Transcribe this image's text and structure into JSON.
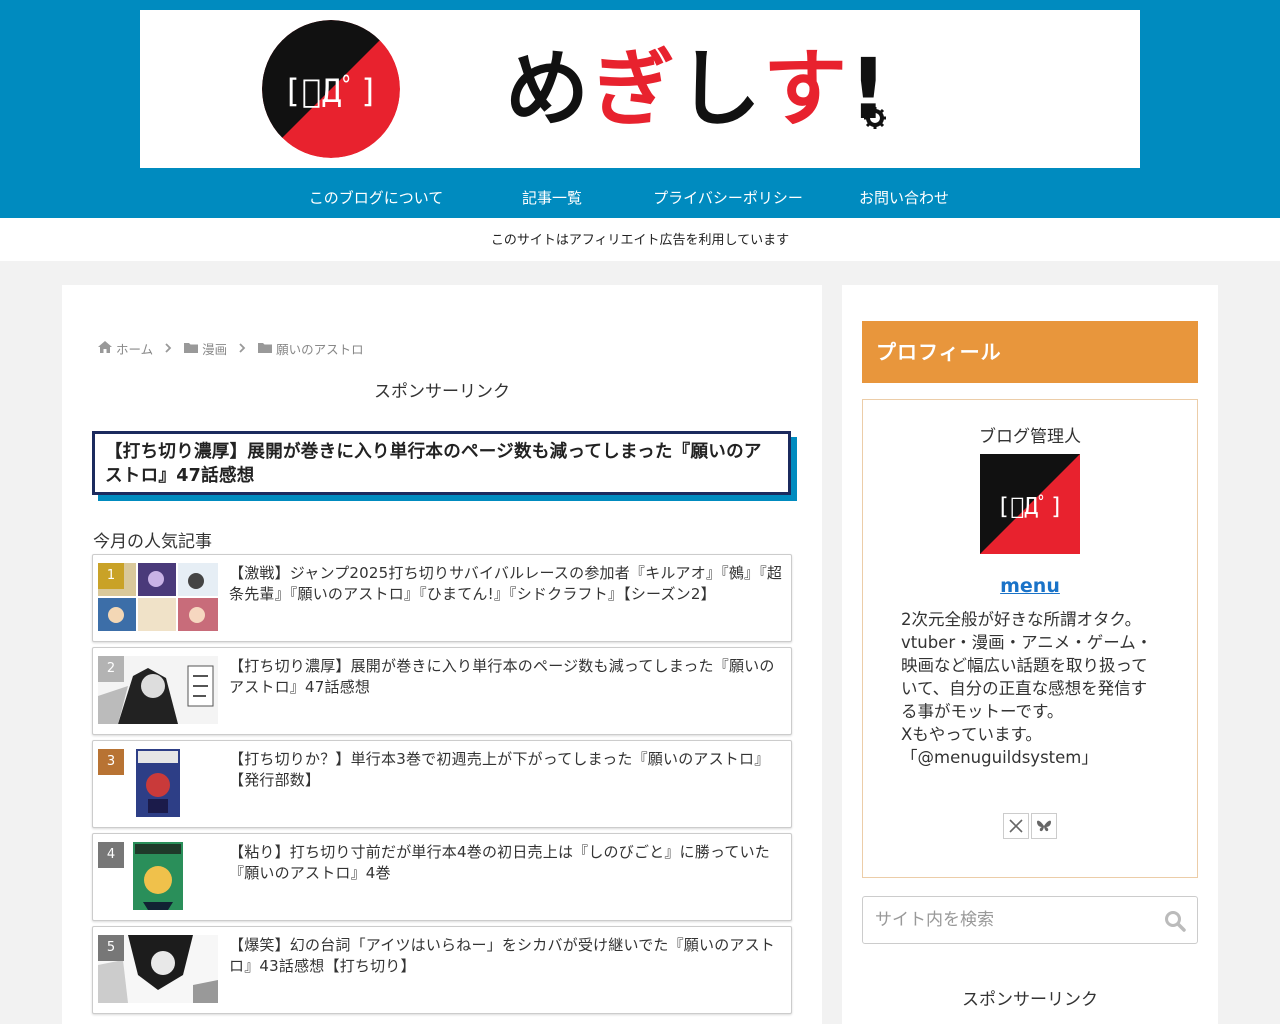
{
  "site": {
    "logo_face": "[ﾟДﾟ]",
    "title_chars": [
      "め",
      "ぎ",
      "し",
      "す",
      "!"
    ],
    "colors": {
      "header_blue": "#008bbf",
      "brand_red": "#e8222e",
      "brand_black": "#111111",
      "profile_orange": "#e8963c",
      "title_border": "#1b2a5e"
    }
  },
  "nav": {
    "items": [
      {
        "label": "このブログについて"
      },
      {
        "label": "記事一覧"
      },
      {
        "label": "プライバシーポリシー"
      },
      {
        "label": "お問い合わせ"
      }
    ]
  },
  "notice": "このサイトはアフィリエイト広告を利用しています",
  "breadcrumb": {
    "home": "ホーム",
    "category": "漫画",
    "subcategory": "願いのアストロ",
    "icons": {
      "home": "home-icon",
      "folder": "folder-icon",
      "separator": "chevron-right-icon"
    }
  },
  "main": {
    "sponsor_label": "スポンサーリンク",
    "article_title": "【打ち切り濃厚】展開が巻きに入り単行本のページ数も減ってしまった『願いのアストロ』47話感想",
    "popular_heading": "今月の人気記事",
    "popular": [
      {
        "rank": "1",
        "title": "【激戦】ジャンプ2025打ち切りサバイバルレースの参加者『キルアオ』『鵺』『超条先輩』『願いのアストロ』『ひまてん!』『シドクラフト』【シーズン2】",
        "badge_color": "#c9a227"
      },
      {
        "rank": "2",
        "title": "【打ち切り濃厚】展開が巻きに入り単行本のページ数も減ってしまった『願いのアストロ』47話感想",
        "badge_color": "#b3b3b3"
      },
      {
        "rank": "3",
        "title": "【打ち切りか？】単行本3巻で初週売上が下がってしまった『願いのアストロ』【発行部数】",
        "badge_color": "#b87333"
      },
      {
        "rank": "4",
        "title": "【粘り】打ち切り寸前だが単行本4巻の初日売上は『しのびごと』に勝っていた『願いのアストロ』4巻",
        "badge_color": "#777777"
      },
      {
        "rank": "5",
        "title": "【爆笑】幻の台詞「アイツはいらねー」をシカバが受け継いでた『願いのアストロ』43話感想【打ち切り】",
        "badge_color": "#777777"
      }
    ]
  },
  "sidebar": {
    "profile_heading": "プロフィール",
    "profile_sub": "ブログ管理人",
    "profile_avatar_face": "[ﾟДﾟ]",
    "profile_name": "menu",
    "bio_lines": [
      "2次元全般が好きな所謂オタク。",
      "vtuber・漫画・アニメ・ゲーム・映画など幅広い話題を取り扱っていて、自分の正直な感想を発信する事がモットーです。",
      "Xもやっています。",
      "「@menuguildsystem」"
    ],
    "social_icons": [
      "x-icon",
      "bluesky-icon"
    ],
    "search": {
      "placeholder": "サイト内を検索",
      "value": ""
    },
    "sponsor_label": "スポンサーリンク"
  }
}
